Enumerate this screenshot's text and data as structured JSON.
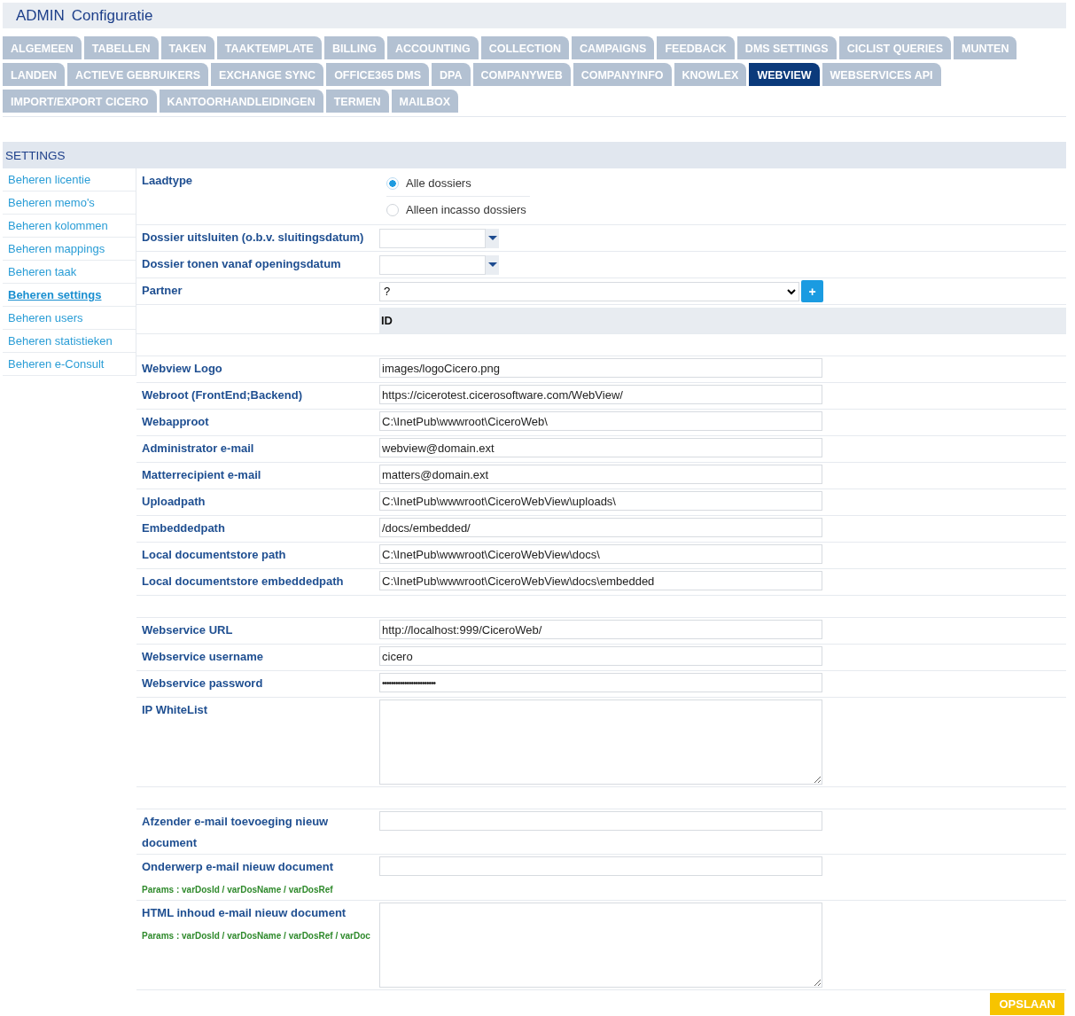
{
  "header": {
    "section": "ADMIN",
    "title": "Configuratie"
  },
  "tab_rows": [
    [
      {
        "label": "ALGEMEEN",
        "selected": false
      },
      {
        "label": "TABELLEN",
        "selected": false
      },
      {
        "label": "TAKEN",
        "selected": false
      },
      {
        "label": "TAAKTEMPLATE",
        "selected": false
      },
      {
        "label": "BILLING",
        "selected": false
      },
      {
        "label": "ACCOUNTING",
        "selected": false
      },
      {
        "label": "COLLECTION",
        "selected": false
      },
      {
        "label": "CAMPAIGNS",
        "selected": false
      },
      {
        "label": "FEEDBACK",
        "selected": false
      },
      {
        "label": "DMS SETTINGS",
        "selected": false
      },
      {
        "label": "CICLIST QUERIES",
        "selected": false
      },
      {
        "label": "MUNTEN",
        "selected": false
      }
    ],
    [
      {
        "label": "LANDEN",
        "selected": false
      },
      {
        "label": "ACTIEVE GEBRUIKERS",
        "selected": false
      },
      {
        "label": "EXCHANGE SYNC",
        "selected": false
      },
      {
        "label": "OFFICE365 DMS",
        "selected": false
      },
      {
        "label": "DPA",
        "selected": false
      },
      {
        "label": "COMPANYWEB",
        "selected": false
      },
      {
        "label": "COMPANYINFO",
        "selected": false
      },
      {
        "label": "KNOWLEX",
        "selected": false
      },
      {
        "label": "WEBVIEW",
        "selected": true
      },
      {
        "label": "WEBSERVICES API",
        "selected": false
      }
    ],
    [
      {
        "label": "IMPORT/EXPORT CICERO",
        "selected": false
      },
      {
        "label": "KANTOORHANDLEIDINGEN",
        "selected": false
      },
      {
        "label": "TERMEN",
        "selected": false
      },
      {
        "label": "MAILBOX",
        "selected": false
      }
    ]
  ],
  "settings": {
    "title": "SETTINGS",
    "sidebar": {
      "items": [
        {
          "label": "Beheren licentie",
          "selected": false
        },
        {
          "label": "Beheren memo's",
          "selected": false
        },
        {
          "label": "Beheren kolommen",
          "selected": false
        },
        {
          "label": "Beheren mappings",
          "selected": false
        },
        {
          "label": "Beheren taak",
          "selected": false
        },
        {
          "label": "Beheren settings",
          "selected": true
        },
        {
          "label": "Beheren users",
          "selected": false
        },
        {
          "label": "Beheren statistieken",
          "selected": false
        },
        {
          "label": "Beheren e-Consult",
          "selected": false
        }
      ]
    },
    "form": {
      "rows": [
        {
          "kind": "radio",
          "label": "Laadtype",
          "options": [
            {
              "label": "Alle dossiers",
              "selected": true
            },
            {
              "label": "Alleen incasso dossiers",
              "selected": false
            }
          ]
        },
        {
          "kind": "date",
          "label": "Dossier uitsluiten (o.b.v. sluitingsdatum)"
        },
        {
          "kind": "date",
          "label": "Dossier tonen vanaf openingsdatum"
        },
        {
          "kind": "select",
          "label": "Partner",
          "value": "?",
          "button": "+"
        },
        {
          "kind": "header",
          "column": "ID"
        },
        {
          "kind": "spacer"
        },
        {
          "kind": "text",
          "label": "Webview Logo",
          "value": "images/logoCicero.png"
        },
        {
          "kind": "text",
          "label": "Webroot (FrontEnd;Backend)",
          "value": "https://cicerotest.cicerosoftware.com/WebView/"
        },
        {
          "kind": "text",
          "label": "Webapproot",
          "value": "C:\\InetPub\\wwwroot\\CiceroWeb\\"
        },
        {
          "kind": "text",
          "label": "Administrator e-mail",
          "value": "webview@domain.ext"
        },
        {
          "kind": "text",
          "label": "Matterrecipient e-mail",
          "value": "matters@domain.ext"
        },
        {
          "kind": "text",
          "label": "Uploadpath",
          "value": "C:\\InetPub\\wwwroot\\CiceroWebView\\uploads\\"
        },
        {
          "kind": "text",
          "label": "Embeddedpath",
          "value": "/docs/embedded/"
        },
        {
          "kind": "text",
          "label": "Local documentstore path",
          "value": "C:\\InetPub\\wwwroot\\CiceroWebView\\docs\\"
        },
        {
          "kind": "text",
          "label": "Local documentstore embeddedpath",
          "value": "C:\\InetPub\\wwwroot\\CiceroWebView\\docs\\embedded"
        },
        {
          "kind": "spacer"
        },
        {
          "kind": "text",
          "label": "Webservice URL",
          "value": "http://localhost:999/CiceroWeb/"
        },
        {
          "kind": "text",
          "label": "Webservice username",
          "value": "cicero"
        },
        {
          "kind": "password",
          "label": "Webservice password",
          "value": "••••••••••••••••••••••••"
        },
        {
          "kind": "textarea",
          "label": "IP WhiteList"
        },
        {
          "kind": "spacer"
        },
        {
          "kind": "text",
          "label": "Afzender e-mail toevoeging nieuw document"
        },
        {
          "kind": "text",
          "label": "Onderwerp e-mail nieuw document",
          "note": "Params : varDosId / varDosName / varDosRef"
        },
        {
          "kind": "textarea",
          "label": "HTML inhoud e-mail nieuw document",
          "note": "Params : varDosId / varDosName / varDosRef / varDoc"
        }
      ]
    },
    "save_button": "OPSLAAN"
  }
}
